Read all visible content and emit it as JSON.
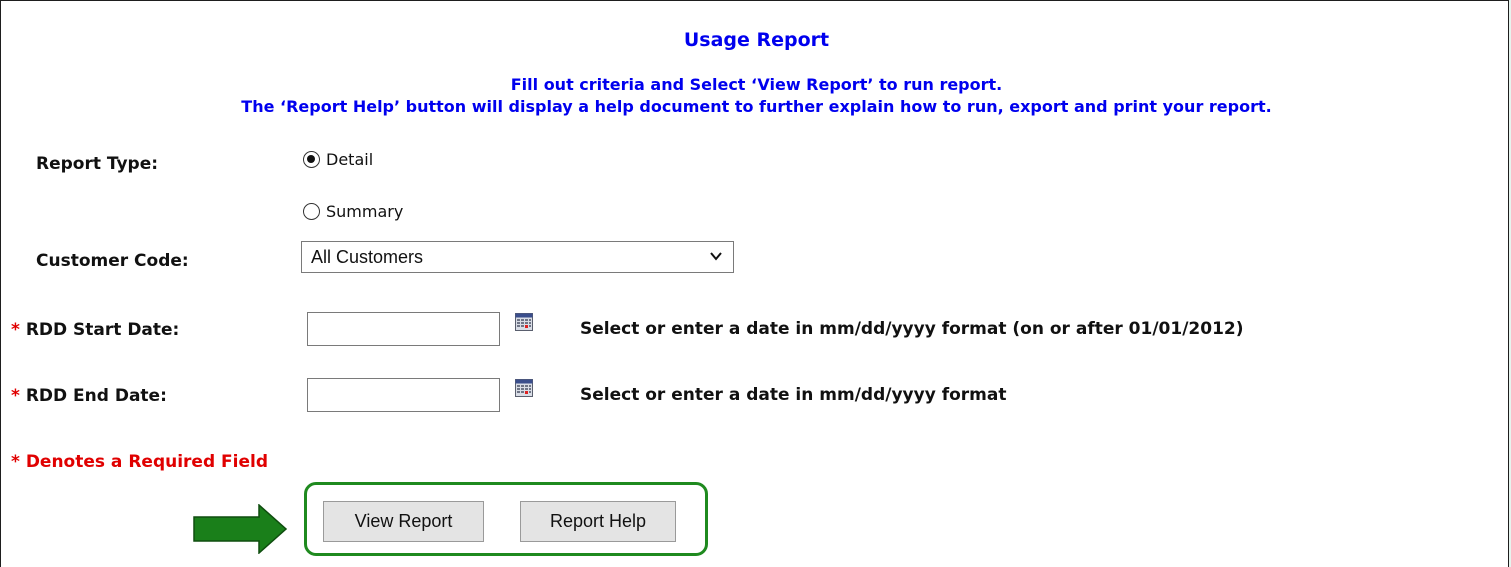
{
  "header": {
    "title": "Usage Report",
    "instruction_line1": "Fill out criteria and Select ‘View Report’ to run report.",
    "instruction_line2": "The ‘Report Help’ button will display a help document to further explain how to run, export and print your report."
  },
  "form": {
    "required_marker": "*",
    "report_type": {
      "label": "Report Type:",
      "options": [
        {
          "label": "Detail",
          "selected": true
        },
        {
          "label": "Summary",
          "selected": false
        }
      ]
    },
    "customer_code": {
      "label": "Customer Code:",
      "selected_value": "All Customers"
    },
    "start_date": {
      "label": "RDD Start Date:",
      "value": "",
      "hint": "Select or enter a date in mm/dd/yyyy format (on or after 01/01/2012)"
    },
    "end_date": {
      "label": "RDD End Date:",
      "value": "",
      "hint": "Select or enter a date in mm/dd/yyyy format"
    },
    "required_note": "Denotes a Required Field"
  },
  "buttons": {
    "view_report": "View Report",
    "report_help": "Report Help"
  },
  "colors": {
    "title_blue": "#0000ee",
    "required_red": "#e00000",
    "highlight_green": "#1f8a1f"
  },
  "icons": [
    "calendar-icon",
    "chevron-down-icon",
    "arrow-right-icon"
  ]
}
